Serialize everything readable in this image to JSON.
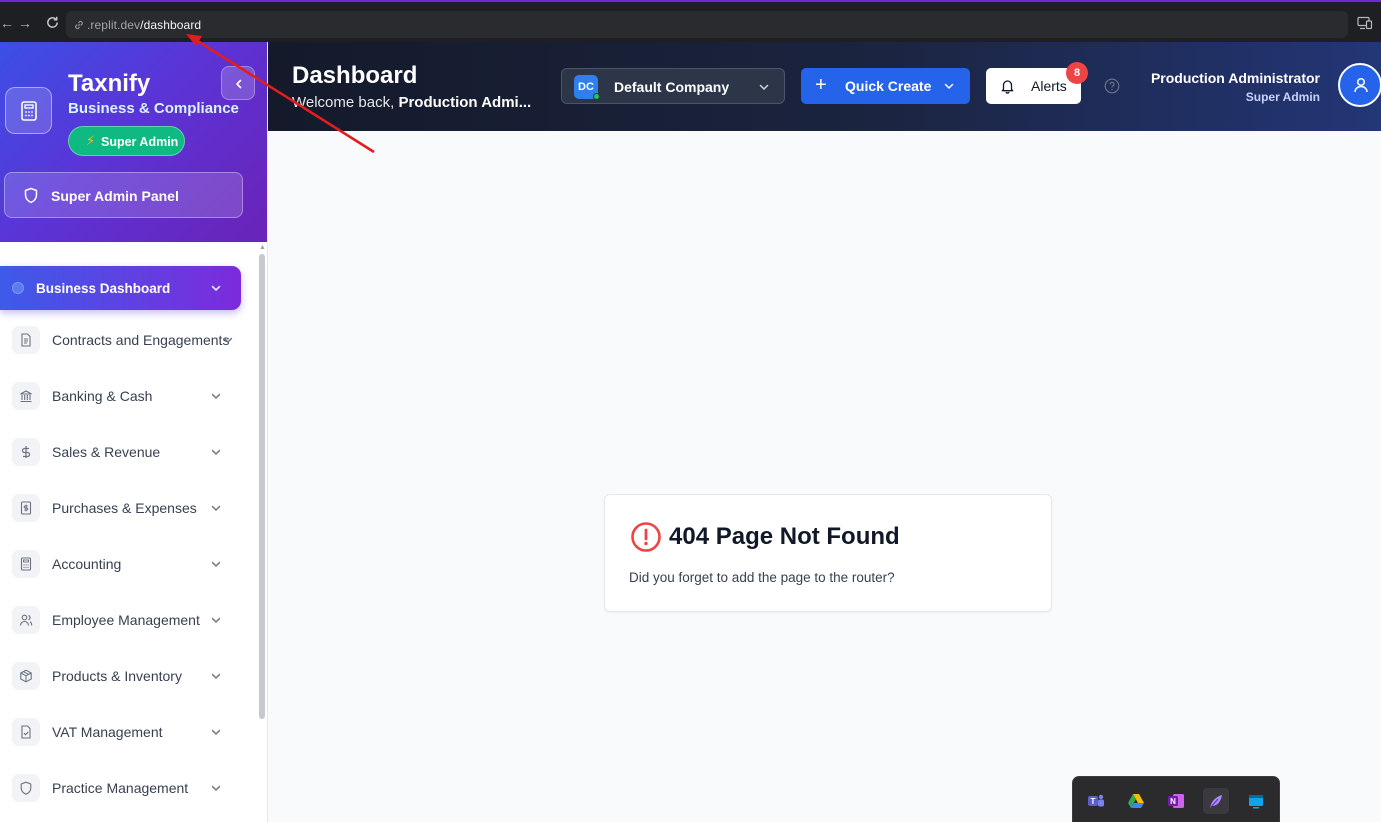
{
  "browser": {
    "url_host": ".replit.dev",
    "url_path": "/dashboard"
  },
  "sidebar": {
    "brand_title": "Taxnify",
    "brand_subtitle": "Business & Compliance",
    "role_badge": "Super Admin",
    "admin_panel_label": "Super Admin Panel",
    "active_item": "Business Dashboard",
    "items": [
      {
        "label": "Contracts and Engagements",
        "icon": "document-icon"
      },
      {
        "label": "Banking & Cash",
        "icon": "bank-icon"
      },
      {
        "label": "Sales & Revenue",
        "icon": "dollar-icon"
      },
      {
        "label": "Purchases & Expenses",
        "icon": "receipt-icon"
      },
      {
        "label": "Accounting",
        "icon": "calculator-icon"
      },
      {
        "label": "Employee Management",
        "icon": "users-icon"
      },
      {
        "label": "Products & Inventory",
        "icon": "package-icon"
      },
      {
        "label": "VAT Management",
        "icon": "file-check-icon"
      },
      {
        "label": "Practice Management",
        "icon": "shield-icon"
      }
    ]
  },
  "header": {
    "title": "Dashboard",
    "welcome_prefix": "Welcome back, ",
    "welcome_name": "Production Admi...",
    "company_initials": "DC",
    "company_name": "Default Company",
    "quick_create_label": "Quick Create",
    "alerts_label": "Alerts",
    "alerts_count": "8",
    "user_name": "Production Administrator",
    "user_role": "Super Admin"
  },
  "main": {
    "error_title": "404 Page Not Found",
    "error_message": "Did you forget to add the page to the router?"
  },
  "colors": {
    "sidebar_gradient_start": "#3b50e6",
    "sidebar_gradient_end": "#6a23b8",
    "primary_blue": "#2563eb",
    "success_green": "#10b981",
    "error_red": "#ef4444",
    "header_dark": "#141a2a",
    "annotation_arrow": "#e11d1d"
  },
  "tray_icons": [
    "teams-icon",
    "google-drive-icon",
    "onenote-icon",
    "feather-app-icon",
    "app-window-icon"
  ]
}
